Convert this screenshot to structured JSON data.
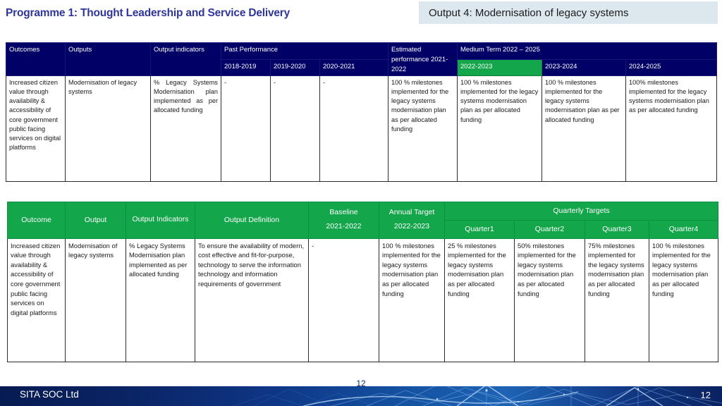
{
  "slide": {
    "title": "Programme 1: Thought Leadership and Service Delivery",
    "output_banner": "Output 4: Modernisation of legacy systems"
  },
  "colors": {
    "navy_header": "#000066",
    "green_header": "#13a64a",
    "highlight_green": "#13a64a",
    "banner_blue": "#dde7ee",
    "title_purple": "#2f3699",
    "footer_blue": "#0f3686"
  },
  "mtef_table": {
    "headers": {
      "outcomes": "Outcomes",
      "outputs": "Outputs",
      "output_indicators": "Output indicators",
      "past_performance": "Past Performance",
      "past_years": [
        "2018-2019",
        "2019-2020",
        "2020-2021"
      ],
      "estimated_performance": "Estimated performance 2021-2022",
      "medium_term": "Medium Term 2022 – 2025",
      "medium_years": [
        "2022-2023",
        "2023-2024",
        "2024-2025"
      ],
      "highlighted_year": "2022-2023"
    },
    "row": {
      "outcome": "Increased citizen value through availability & accessibility of core government public facing services on digital platforms",
      "output": "Modernisation of legacy systems",
      "output_indicator": "% Legacy Systems Modernisation plan implemented as per allocated funding",
      "y2018_2019": "-",
      "y2019_2020": "-",
      "y2020_2021": "-",
      "estimated_2021_2022": "100 % milestones implemented for the legacy systems modernisation plan as per allocated funding",
      "y2022_2023": "100 % milestones implemented for the legacy systems modernisation plan as per allocated funding",
      "y2023_2024": "100 % milestones implemented for the legacy systems modernisation plan as per allocated funding",
      "y2024_2025": "100% milestones implemented for the legacy systems modernisation plan as per allocated funding"
    }
  },
  "apr_table": {
    "headers": {
      "outcome": "Outcome",
      "output": "Output",
      "output_indicators": "Output Indicators",
      "output_definition": "Output Definition",
      "baseline": "Baseline",
      "baseline_year": "2021-2022",
      "annual_target": "Annual Target",
      "annual_target_year": "2022-2023",
      "quarterly_targets": "Quarterly Targets",
      "quarters": [
        "Quarter1",
        "Quarter2",
        "Quarter3",
        "Quarter4"
      ]
    },
    "row": {
      "outcome": "Increased citizen value through availability & accessibility of core government public facing services on digital platforms",
      "output": "Modernisation of legacy systems",
      "output_indicator": "% Legacy Systems Modernisation plan implemented as per allocated funding",
      "output_definition": "To ensure the availability of modern, cost effective and fit-for-purpose, technology to serve the information technology and information requirements of government",
      "baseline": "-",
      "annual_target": "100 % milestones implemented for the legacy systems modernisation plan as per allocated funding",
      "quarter1": "25 %  milestones implemented for the legacy systems modernisation plan as per allocated funding",
      "quarter2": "50% milestones implemented for the legacy systems modernisation plan as per allocated funding",
      "quarter3": "75% milestones implemented for the legacy systems modernisation plan as per allocated funding",
      "quarter4": "100 % milestones implemented for the legacy systems modernisation plan as per allocated funding"
    }
  },
  "footer": {
    "organisation": "SITA SOC Ltd",
    "page_number": "12",
    "center_page_number": "12"
  }
}
